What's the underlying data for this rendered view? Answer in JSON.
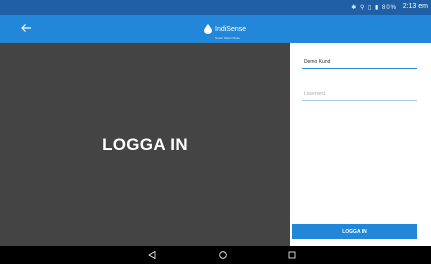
{
  "status_bar": {
    "icons": "✱ ⚲ ▯ ▮ 80%",
    "time": "2:13 em"
  },
  "app_bar": {
    "back_icon": "arrow-left",
    "logo_text": "IndiSense",
    "logo_subtext": "Smart Water Meter",
    "colors": {
      "status": "#1f5fa6",
      "app_bar": "#2287d8"
    }
  },
  "left_panel": {
    "heading": "LOGGA IN",
    "background": "#444444"
  },
  "login_form": {
    "username_value": "Demo Kund",
    "password_placeholder": "Lösenord",
    "button_label": "LOGGA IN",
    "accent": "#2287d8"
  },
  "nav_bar": {
    "back_icon": "triangle-back",
    "home_icon": "circle-home",
    "recent_icon": "square-recents"
  }
}
